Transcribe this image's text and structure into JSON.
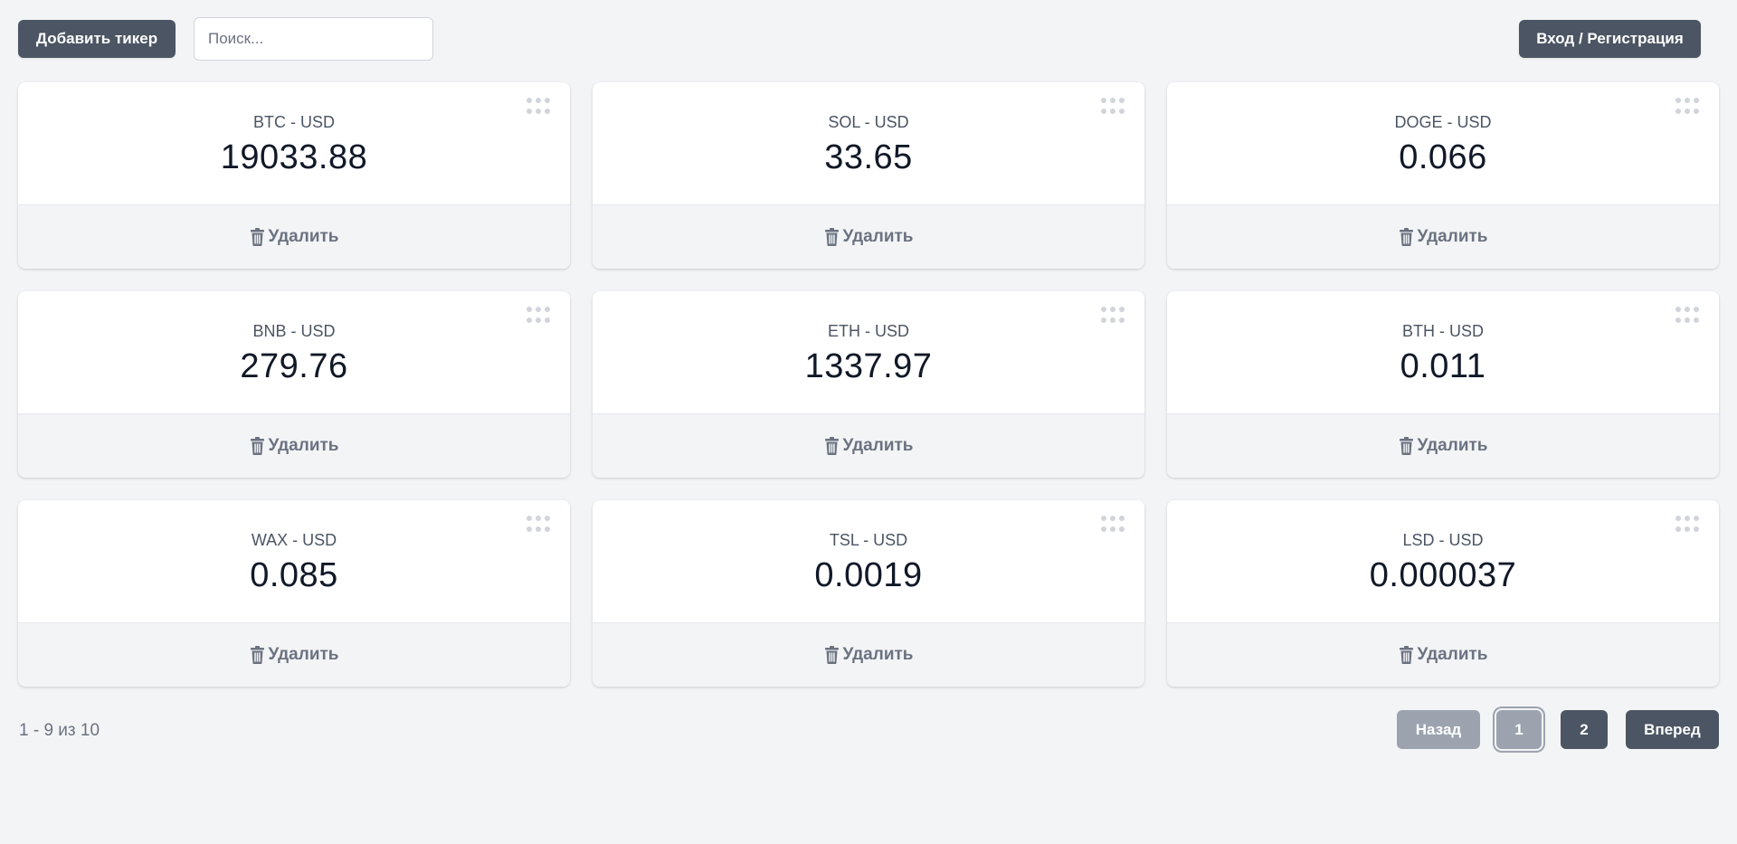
{
  "header": {
    "add_ticker_label": "Добавить тикер",
    "search_placeholder": "Поиск...",
    "login_label": "Вход / Регистрация"
  },
  "tickers": [
    {
      "name": "BTC - USD",
      "price": "19033.88",
      "delete_label": "Удалить"
    },
    {
      "name": "SOL - USD",
      "price": "33.65",
      "delete_label": "Удалить"
    },
    {
      "name": "DOGE - USD",
      "price": "0.066",
      "delete_label": "Удалить"
    },
    {
      "name": "BNB - USD",
      "price": "279.76",
      "delete_label": "Удалить"
    },
    {
      "name": "ETH - USD",
      "price": "1337.97",
      "delete_label": "Удалить"
    },
    {
      "name": "BTH - USD",
      "price": "0.011",
      "delete_label": "Удалить"
    },
    {
      "name": "WAX - USD",
      "price": "0.085",
      "delete_label": "Удалить"
    },
    {
      "name": "TSL - USD",
      "price": "0.0019",
      "delete_label": "Удалить"
    },
    {
      "name": "LSD - USD",
      "price": "0.000037",
      "delete_label": "Удалить"
    }
  ],
  "pagination": {
    "range_text": "1 - 9 из 10",
    "prev_label": "Назад",
    "pages": [
      "1",
      "2"
    ],
    "current_page": "1",
    "next_label": "Вперед"
  },
  "colors": {
    "background": "#f3f4f6",
    "button_dark": "#4b5563",
    "button_disabled": "#9ca3af"
  },
  "icons": {
    "delete": "trash-icon",
    "drag": "drag-handle-icon"
  }
}
